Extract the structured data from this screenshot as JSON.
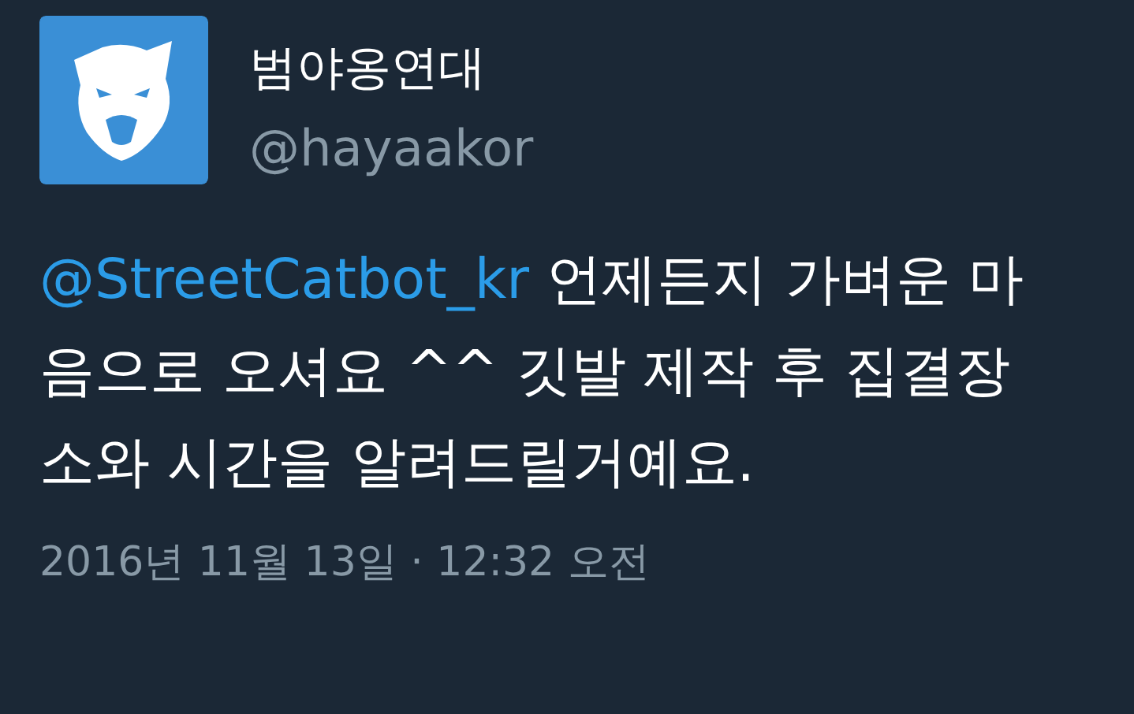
{
  "author": {
    "name": "범야옹연대",
    "handle": "@hayaakor"
  },
  "tweet": {
    "mention": "@StreetCatbot_kr",
    "text": "언제든지 가벼운 마음으로 오셔요 ^^ 깃발 제작 후 집결장소와 시간을 알려드릴거예요."
  },
  "timestamp": "2016년 11월 13일 · 12:32 오전"
}
